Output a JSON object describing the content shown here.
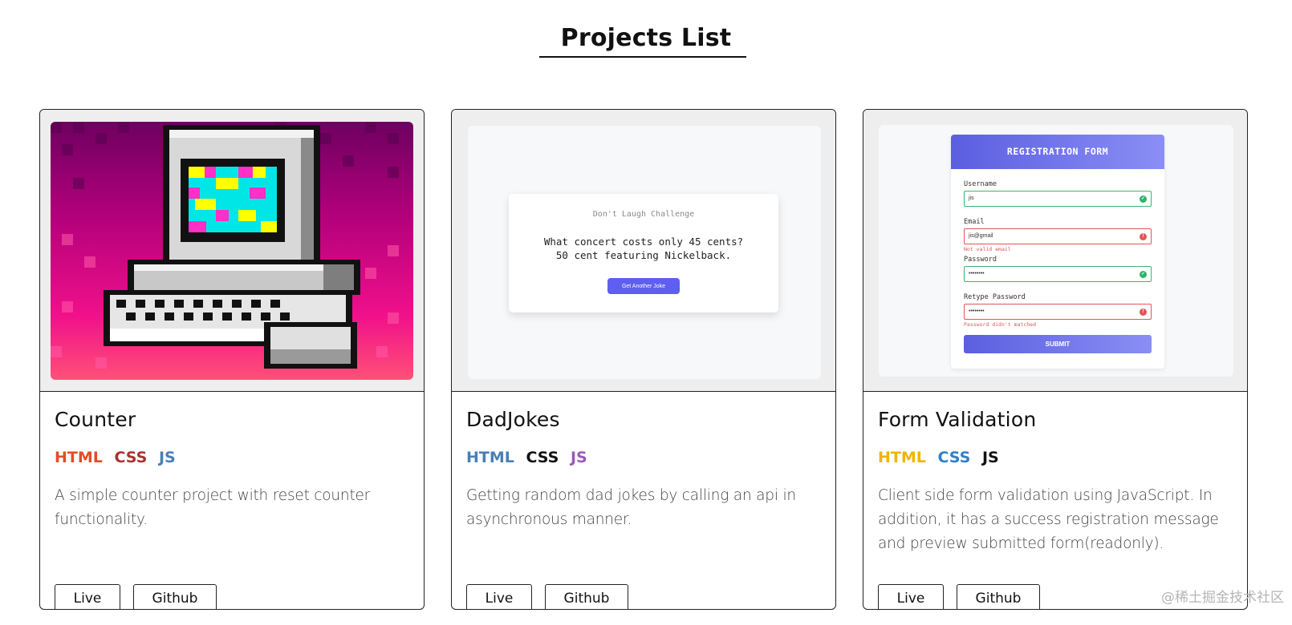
{
  "page": {
    "title": "Projects List"
  },
  "projects": [
    {
      "title": "Counter",
      "tags": [
        {
          "label": "HTML",
          "color": "#e34c26"
        },
        {
          "label": "CSS",
          "color": "#a83232"
        },
        {
          "label": "JS",
          "color": "#4a7fb5"
        }
      ],
      "description": "A simple counter project with reset counter functionality.",
      "live_label": "Live",
      "github_label": "Github"
    },
    {
      "title": "DadJokes",
      "tags": [
        {
          "label": "HTML",
          "color": "#4a7fb5"
        },
        {
          "label": "CSS",
          "color": "#111111"
        },
        {
          "label": "JS",
          "color": "#9b59b6"
        }
      ],
      "description": "Getting random dad jokes by calling an api in asynchronous manner.",
      "live_label": "Live",
      "github_label": "Github",
      "preview": {
        "heading": "Don't Laugh Challenge",
        "joke_line1": "What concert costs only 45 cents?",
        "joke_line2": "50 cent featuring Nickelback.",
        "button": "Get Another Joke"
      }
    },
    {
      "title": "Form Validation",
      "tags": [
        {
          "label": "HTML",
          "color": "#f0b400"
        },
        {
          "label": "CSS",
          "color": "#2f80c8"
        },
        {
          "label": "JS",
          "color": "#111111"
        }
      ],
      "description": "Client side form validation using JavaScript. In addition, it has a success registration message and preview submitted form(readonly).",
      "live_label": "Live",
      "github_label": "Github",
      "preview": {
        "heading": "REGISTRATION FORM",
        "username_label": "Username",
        "username_value": "jis",
        "email_label": "Email",
        "email_value": "jis@gmail",
        "email_error": "Not valid email",
        "password_label": "Password",
        "password_value": "••••••••",
        "retype_label": "Retype Password",
        "retype_value": "••••••••",
        "retype_error": "Password didn't matched",
        "submit": "SUBMIT"
      }
    }
  ],
  "watermark": "@稀土掘金技术社区"
}
